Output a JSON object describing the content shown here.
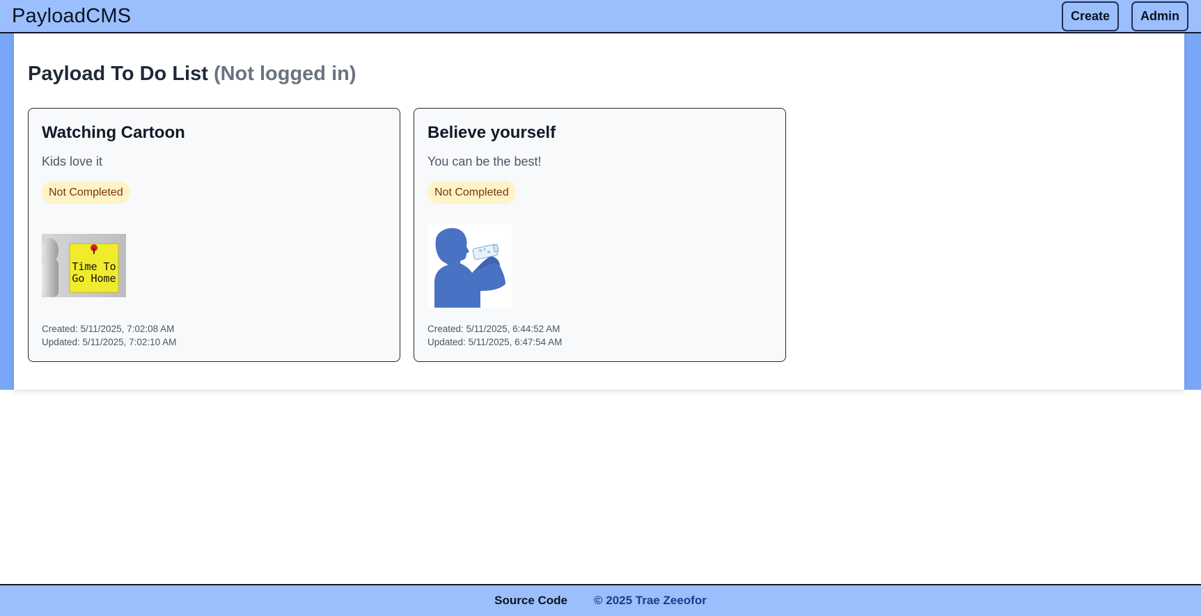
{
  "header": {
    "brand": "PayloadCMS",
    "create_label": "Create",
    "admin_label": "Admin"
  },
  "page": {
    "title": "Payload To Do List",
    "status": "(Not logged in)"
  },
  "todos": [
    {
      "title": "Watching Cartoon",
      "description": "Kids love it",
      "status": "Not Completed",
      "image_text_line1": "Time To",
      "image_text_line2": "Go Home",
      "created": "Created: 5/11/2025, 7:02:08 AM",
      "updated": "Updated: 5/11/2025, 7:02:10 AM"
    },
    {
      "title": "Believe yourself",
      "description": "You can be the best!",
      "status": "Not Completed",
      "created": "Created: 5/11/2025, 6:44:52 AM",
      "updated": "Updated: 5/11/2025, 6:47:54 AM"
    }
  ],
  "footer": {
    "source_label": "Source Code",
    "copyright": "© 2025 Trae Zeeofor"
  },
  "colors": {
    "header_bg": "#9bbffd",
    "band_bg": "#79a6f6",
    "badge_bg": "#fef3c7",
    "badge_text": "#78350f",
    "copyright_text": "#1e3a8a"
  }
}
